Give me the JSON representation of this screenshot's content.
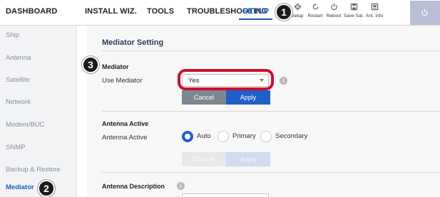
{
  "nav": {
    "tabs": [
      {
        "label": "DASHBOARD"
      },
      {
        "label": "INSTALL WIZ."
      },
      {
        "label": "TOOLS"
      },
      {
        "label": "TROUBLESHOOTING"
      },
      {
        "label": "SETUP"
      }
    ],
    "tools": [
      {
        "label": "Setup",
        "icon": "gear-icon"
      },
      {
        "label": "Restart",
        "icon": "restart-icon"
      },
      {
        "label": "Reboot",
        "icon": "power-icon"
      },
      {
        "label": "Save Sat.",
        "icon": "save-icon"
      },
      {
        "label": "Ant. Info",
        "icon": "info-card-icon"
      }
    ],
    "power_icon": "power-icon",
    "active_tab_color": "#1a5bbf"
  },
  "sidebar": {
    "items": [
      {
        "label": "Ship"
      },
      {
        "label": "Antenna"
      },
      {
        "label": "Satellite"
      },
      {
        "label": "Network"
      },
      {
        "label": "Modem/BUC"
      },
      {
        "label": "SNMP"
      },
      {
        "label": "Backup & Restore"
      },
      {
        "label": "Mediator"
      }
    ]
  },
  "main": {
    "title": "Mediator Setting",
    "mediator": {
      "section_title": "Mediator",
      "label": "Use Mediator",
      "value": "Yes",
      "cancel_label": "Cancel",
      "apply_label": "Apply"
    },
    "antenna_active": {
      "section_title": "Antenna Active",
      "label": "Antenna Active",
      "options": [
        {
          "label": "Auto",
          "selected": true
        },
        {
          "label": "Primary",
          "selected": false
        },
        {
          "label": "Secondary",
          "selected": false
        }
      ],
      "cancel_label": "Cancel",
      "apply_label": "Apply"
    },
    "antenna_description": {
      "section_title": "Antenna Description"
    }
  },
  "callouts": [
    "1",
    "2",
    "3"
  ],
  "colors": {
    "accent": "#1f5fc7",
    "highlight": "#c8102e",
    "cancel": "#7e8790"
  }
}
